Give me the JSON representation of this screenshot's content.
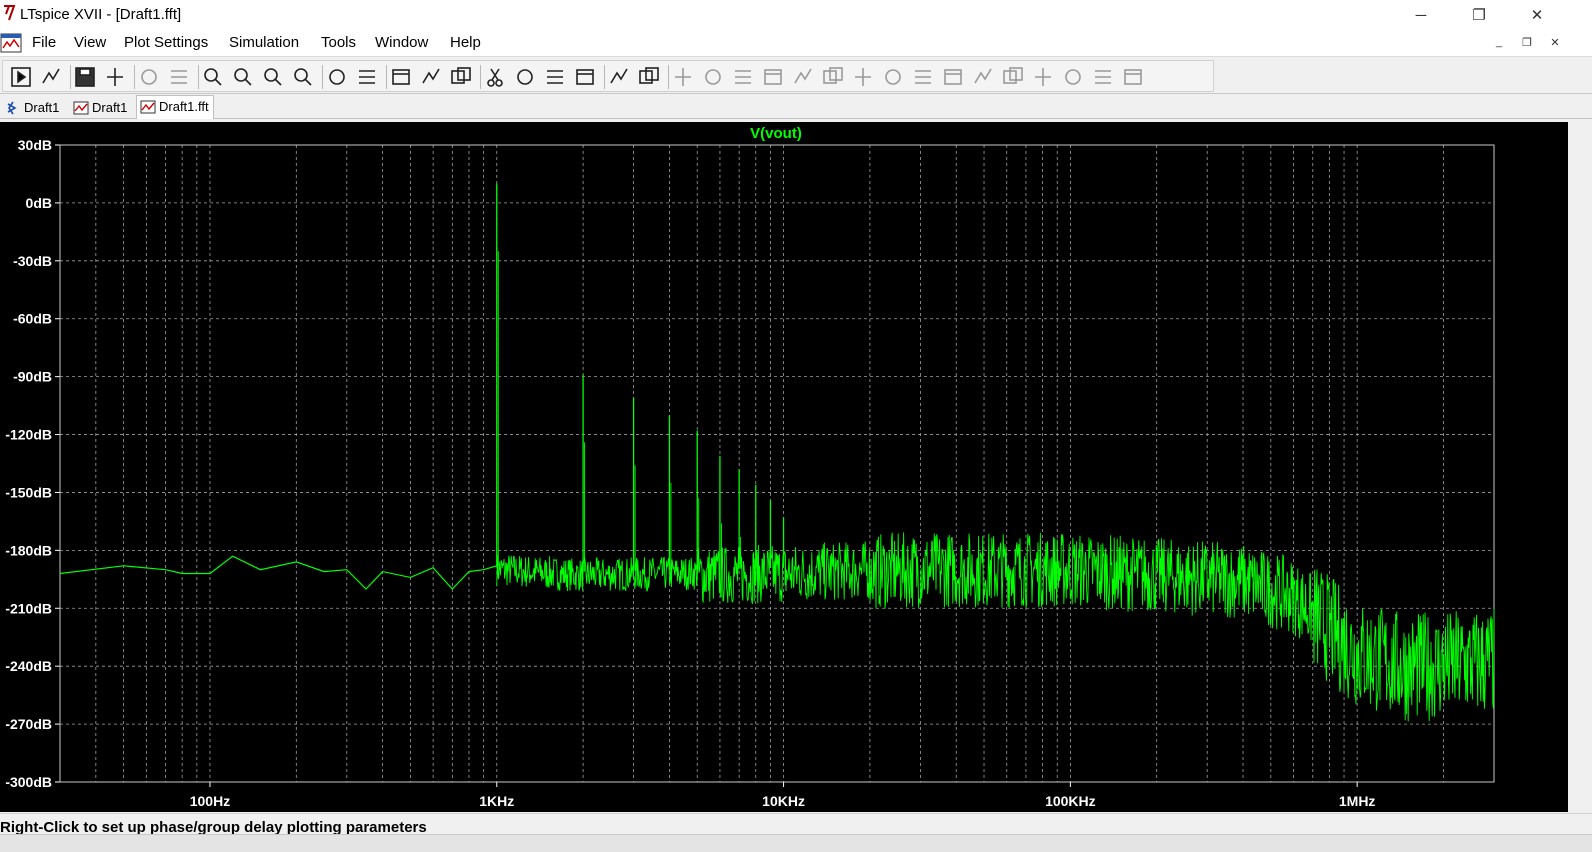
{
  "window": {
    "title": "LTspice XVII - [Draft1.fft]",
    "controls": {
      "minimize": "─",
      "restore": "❐",
      "close": "✕"
    },
    "mdi_controls": {
      "minimize": "_",
      "restore": "❐",
      "close": "✕"
    }
  },
  "menu": {
    "items": [
      {
        "label": "File"
      },
      {
        "label": "View"
      },
      {
        "label": "Plot Settings"
      },
      {
        "label": "Simulation"
      },
      {
        "label": "Tools"
      },
      {
        "label": "Window"
      },
      {
        "label": "Help"
      }
    ]
  },
  "toolbar": {
    "icons": [
      "run-icon",
      "open-icon",
      "save-icon",
      "control-panel-icon",
      "halt-icon",
      "pan-icon",
      "zoom-in-icon",
      "zoom-area-icon",
      "zoom-out-icon",
      "zoom-fit-icon",
      "autorange-icon",
      "manual-limits-icon",
      "tile-horizontal-icon",
      "cascade-icon",
      "tile-vertical-icon",
      "cut-icon",
      "copy-icon",
      "paste-icon",
      "find-icon",
      "print-icon",
      "print-preview-icon",
      "wire-icon",
      "ground-icon",
      "label-net-icon",
      "resistor-icon",
      "capacitor-icon",
      "inductor-icon",
      "diode-icon",
      "component-icon",
      "move-icon",
      "drag-icon",
      "undo-icon",
      "redo-icon",
      "rotate-icon",
      "mirror-icon",
      "text-icon",
      "spice-directive-icon"
    ]
  },
  "tabs": [
    {
      "label": "Draft1",
      "icon": "schematic-icon"
    },
    {
      "label": "Draft1",
      "icon": "waveform-icon"
    },
    {
      "label": "Draft1.fft",
      "icon": "fft-icon",
      "active": true
    }
  ],
  "plot": {
    "trace_label": "V(vout)",
    "background": "#000000",
    "trace_color": "#00ff00",
    "grid_color": "#a0a0a0"
  },
  "chart_data": {
    "type": "line",
    "title": "V(vout)",
    "xscale": "log",
    "xlim_hz": [
      30,
      3000000
    ],
    "ylim_db": [
      -300,
      30
    ],
    "yticks": [
      "30dB",
      "0dB",
      "-30dB",
      "-60dB",
      "-90dB",
      "-120dB",
      "-150dB",
      "-180dB",
      "-210dB",
      "-240dB",
      "-270dB",
      "-300dB"
    ],
    "yvalues": [
      30,
      0,
      -30,
      -60,
      -90,
      -120,
      -150,
      -180,
      -210,
      -240,
      -270,
      -300
    ],
    "xticks": [
      "100Hz",
      "1KHz",
      "10KHz",
      "100KHz",
      "1MHz"
    ],
    "xvalues": [
      100,
      1000,
      10000,
      100000,
      1000000
    ],
    "grid": true,
    "series": [
      {
        "name": "V(vout)",
        "color": "#00ff00",
        "baseline": [
          [
            30,
            -192
          ],
          [
            50,
            -188
          ],
          [
            70,
            -190
          ],
          [
            80,
            -192
          ],
          [
            100,
            -192
          ],
          [
            120,
            -183
          ],
          [
            150,
            -190
          ],
          [
            200,
            -186
          ],
          [
            250,
            -191
          ],
          [
            300,
            -190
          ],
          [
            350,
            -200
          ],
          [
            400,
            -191
          ],
          [
            500,
            -194
          ],
          [
            600,
            -189
          ],
          [
            700,
            -200
          ],
          [
            800,
            -191
          ],
          [
            900,
            -190
          ],
          [
            1000,
            -188
          ],
          [
            1500,
            -190
          ],
          [
            2000,
            -191
          ],
          [
            5000,
            -190
          ],
          [
            10000,
            -189
          ],
          [
            30000,
            -186
          ],
          [
            100000,
            -186
          ],
          [
            200000,
            -189
          ],
          [
            400000,
            -192
          ],
          [
            600000,
            -200
          ],
          [
            800000,
            -215
          ],
          [
            1000000,
            -228
          ],
          [
            1500000,
            -235
          ],
          [
            3000000,
            -232
          ]
        ],
        "spikes": [
          [
            1000,
            10
          ],
          [
            2000,
            -89
          ],
          [
            3000,
            -101
          ],
          [
            4000,
            -110
          ],
          [
            5000,
            -118
          ],
          [
            6000,
            -131
          ],
          [
            7000,
            -138
          ],
          [
            8000,
            -146
          ],
          [
            9000,
            -154
          ],
          [
            10000,
            -163
          ]
        ]
      }
    ]
  },
  "status": {
    "text": "Right-Click to set up phase/group delay plotting parameters"
  }
}
